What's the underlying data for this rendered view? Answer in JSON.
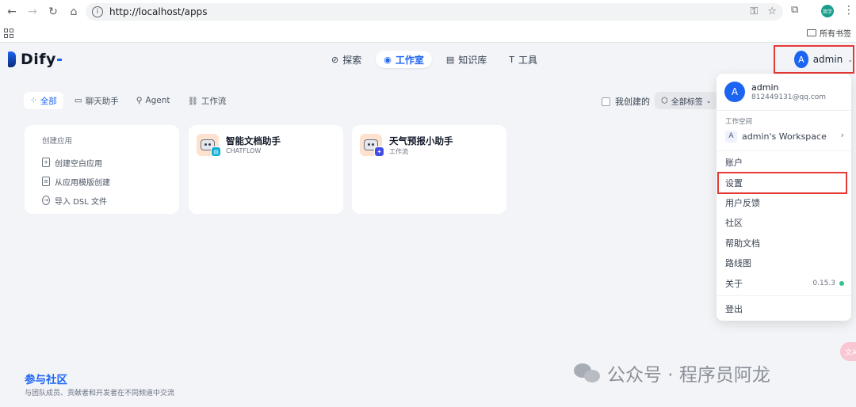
{
  "browser": {
    "url": "http://localhost/apps",
    "bookmarks_label": "所有书签",
    "profile_text": "简学"
  },
  "header": {
    "logo_text": "Dify",
    "nav": [
      {
        "label": "探索",
        "icon": "compass-icon"
      },
      {
        "label": "工作室",
        "icon": "robot-icon",
        "active": true
      },
      {
        "label": "知识库",
        "icon": "book-icon"
      },
      {
        "label": "工具",
        "icon": "hammer-icon"
      }
    ],
    "user": {
      "avatar_letter": "A",
      "name": "admin"
    }
  },
  "filters": {
    "tabs": [
      {
        "label": "全部",
        "active": true,
        "icon": "grid-icon"
      },
      {
        "label": "聊天助手",
        "icon": "chat-icon"
      },
      {
        "label": "Agent",
        "icon": "agent-icon"
      },
      {
        "label": "工作流",
        "icon": "workflow-icon"
      }
    ],
    "mine_label": "我创建的",
    "tags_label": "全部标签"
  },
  "create_card": {
    "title": "创建应用",
    "items": [
      "创建空白应用",
      "从应用模版创建",
      "导入 DSL 文件"
    ]
  },
  "apps": [
    {
      "name": "智能文档助手",
      "type": "CHATFLOW",
      "badge_color": "#06aed4"
    },
    {
      "name": "天气预报小助手",
      "type": "工作流",
      "badge_color": "#444ce7"
    }
  ],
  "community": {
    "title": "参与社区",
    "desc": "与团队成员、贡献者和开发者在不同频道中交流"
  },
  "watermark": {
    "text": "公众号 · 程序员阿龙"
  },
  "float_bubble": {
    "text": "文A"
  },
  "dropdown": {
    "avatar_letter": "A",
    "name": "admin",
    "email": "812449131@qq.com",
    "workspace_label": "工作空间",
    "workspace_letter": "A",
    "workspace_name": "admin's Workspace",
    "items": [
      "账户",
      "设置",
      "用户反馈",
      "社区",
      "帮助文档",
      "路线图",
      "关于"
    ],
    "version": "0.15.3",
    "logout": "登出"
  },
  "colors": {
    "accent": "#1c64f2",
    "highlight": "#e53935",
    "status_ok": "#31c48d"
  }
}
